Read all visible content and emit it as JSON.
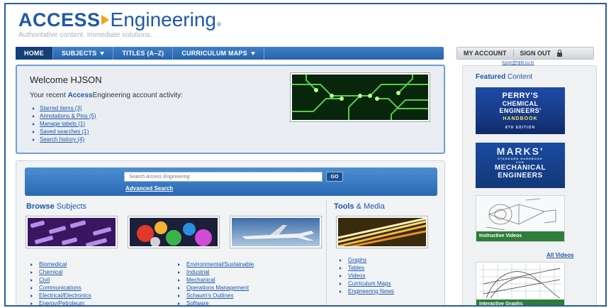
{
  "header": {
    "logo_access": "ACCESS",
    "logo_engineering": "Engineering",
    "tagline": "Authoritative content. Immediate solutions."
  },
  "nav": {
    "items": [
      {
        "label": "HOME",
        "dropdown": false,
        "active": true
      },
      {
        "label": "SUBJECTS",
        "dropdown": true,
        "active": false
      },
      {
        "label": "TITLES (A–Z)",
        "dropdown": false,
        "active": false
      },
      {
        "label": "CURRICULUM MAPS",
        "dropdown": true,
        "active": false
      }
    ]
  },
  "account": {
    "my_account": "MY ACCOUNT",
    "sign_out": "SIGN OUT",
    "email": "hjson@hjlib.co.kr"
  },
  "welcome": {
    "title": "Welcome HJSON",
    "activity_prefix": "Your recent ",
    "activity_brand_bold": "Access",
    "activity_suffix": "Engineering account activity:",
    "links": [
      "Starred items (3)",
      "Annotations & Pins (5)",
      "Manage labels (1)",
      "Saved searches (1)",
      "Search history (4)"
    ]
  },
  "search": {
    "placeholder": "Search Access Engineering",
    "go_label": "GO",
    "advanced_label": "Advanced Search"
  },
  "browse": {
    "title_bold": "Browse",
    "title_rest": " Subjects",
    "col1": [
      "Biomedical",
      "Chemical",
      "Civil",
      "Communications",
      "Electrical/Electronics",
      "Energy/Petroleum"
    ],
    "col2": [
      "Environmental/Sustainable",
      "Industrial",
      "Mechanical",
      "Operations Management",
      "Schaum's Outlines",
      "Software"
    ]
  },
  "tools": {
    "title_bold": "Tools",
    "title_rest": " & Media",
    "items": [
      "Graphs",
      "Tables",
      "Videos",
      "Curriculum Maps",
      "Engineering News"
    ]
  },
  "featured": {
    "title_bold": "Featured",
    "title_rest": " Content",
    "perry": {
      "line1": "PERRY'S",
      "line2": "CHEMICAL",
      "line3": "ENGINEERS'",
      "line4": "HANDBOOK",
      "line5": "8TH EDITION"
    },
    "marks": {
      "line1": "MARKS'",
      "line2": "STANDARD HANDBOOK",
      "line3": "FOR",
      "line4": "MECHANICAL",
      "line5": "ENGINEERS"
    },
    "video_banner": "Instructive Videos",
    "all_videos": "All Videos",
    "graph_banner": "Interactive Graphs"
  },
  "colors": {
    "brand_blue": "#1f58a8",
    "nav_blue": "#2663ab",
    "accent_orange": "#f4a21c",
    "banner_green": "#2e7d3a"
  }
}
